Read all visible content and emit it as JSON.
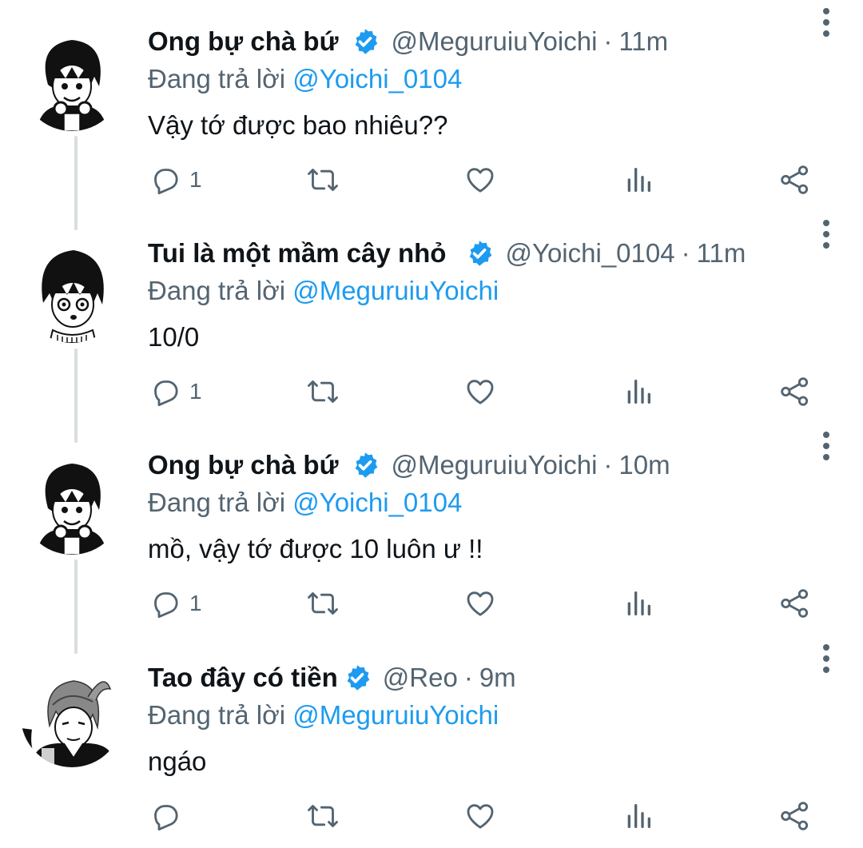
{
  "tweets": [
    {
      "display_name": "Ong bự chà bứ",
      "handle": "@MeguruiuYoichi",
      "time": "11m",
      "reply_prefix": "Đang trả lời",
      "reply_to": "@Yoichi_0104",
      "text": "Vậy tớ được bao nhiêu??",
      "reply_count": "1",
      "verified": true,
      "avatar": "avatar-bachira"
    },
    {
      "display_name": "Tui là một mầm cây nhỏ",
      "handle": "@Yoichi_0104",
      "time": "11m",
      "reply_prefix": "Đang trả lời",
      "reply_to": "@MeguruiuYoichi",
      "text": "10/0",
      "reply_count": "1",
      "verified": true,
      "avatar": "avatar-isagi"
    },
    {
      "display_name": "Ong bự chà bứ",
      "handle": "@MeguruiuYoichi",
      "time": "10m",
      "reply_prefix": "Đang trả lời",
      "reply_to": "@Yoichi_0104",
      "text": "mồ, vậy tớ được 10 luôn ư !!",
      "reply_count": "1",
      "verified": true,
      "avatar": "avatar-bachira"
    },
    {
      "display_name": "Tao đây có tiền",
      "handle": "@Reo",
      "time": "9m",
      "reply_prefix": "Đang trả lời",
      "reply_to": "@MeguruiuYoichi",
      "text": "ngáo",
      "reply_count": "",
      "verified": true,
      "avatar": "avatar-reo"
    }
  ],
  "separator": "·",
  "icons": {
    "verified": "verified-badge-icon",
    "more": "more-vertical-icon",
    "reply": "reply-icon",
    "retweet": "retweet-icon",
    "like": "like-heart-icon",
    "views": "views-chart-icon",
    "share": "share-icon"
  },
  "colors": {
    "accent": "#1d9bf0",
    "secondary_text": "#536471",
    "primary_text": "#0f1419",
    "thread_line": "#d9dde0"
  }
}
